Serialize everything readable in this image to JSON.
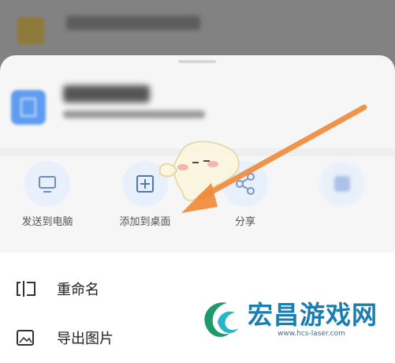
{
  "header": {
    "app_icon": "app-icon",
    "title": ""
  },
  "file": {
    "icon": "file-doc-icon",
    "name": "",
    "meta": ""
  },
  "actions": [
    {
      "label": "发送到电脑",
      "icon": "monitor-icon"
    },
    {
      "label": "添加到桌面",
      "icon": "add-square-icon"
    },
    {
      "label": "分享",
      "icon": "share-icon"
    },
    {
      "label": "",
      "icon": "app-icon"
    }
  ],
  "menu": [
    {
      "label": "重命名",
      "icon": "rename-icon"
    },
    {
      "label": "导出图片",
      "icon": "export-image-icon"
    }
  ],
  "overlay": {
    "arrow_color": "#f08a3a",
    "mascot": "mascot-sticker"
  },
  "watermark": {
    "brand": "宏昌游戏网",
    "url": "www.hcs-laser.com",
    "brand_color": "#1a7fb0"
  }
}
